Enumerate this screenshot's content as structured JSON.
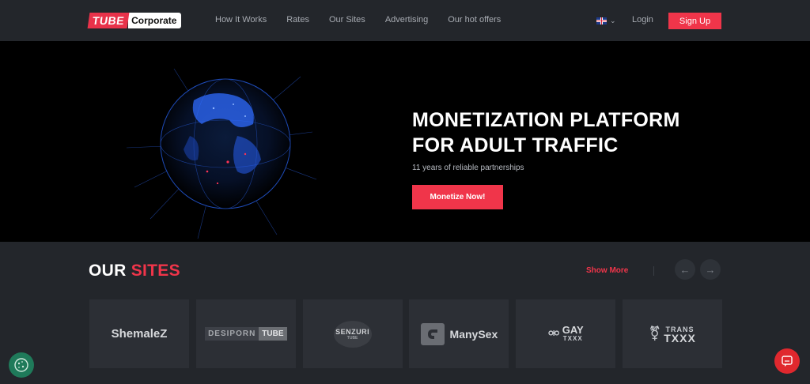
{
  "header": {
    "logo_tube": "TUBE",
    "logo_corp": "Corporate",
    "nav": [
      "How It Works",
      "Rates",
      "Our Sites",
      "Advertising",
      "Our hot offers"
    ],
    "language_icon": "uk-flag-icon",
    "login": "Login",
    "signup": "Sign Up"
  },
  "hero": {
    "title_line1": "MONETIZATION PLATFORM",
    "title_line2": "FOR ADULT TRAFFIC",
    "subtitle": "11 years of reliable partnerships",
    "cta": "Monetize Now!"
  },
  "sites": {
    "title_white": "OUR ",
    "title_red": "SITES",
    "show_more": "Show More",
    "prev_icon": "arrow-left-icon",
    "next_icon": "arrow-right-icon",
    "cards": {
      "shemalez": "ShemaleZ",
      "desi_a": "DESIPORN",
      "desi_b": "TUBE",
      "senzuri_a": "SENZURI",
      "senzuri_b": "TUBE",
      "manysex": "ManySex",
      "gay_a": "GAY",
      "gay_b": "TXXX",
      "trans_a": "TRANS",
      "trans_b": "TXXX"
    }
  },
  "colors": {
    "accent": "#f0354a",
    "background": "#23262b",
    "card": "#2c2f35",
    "cookie": "#1f7a5a",
    "chat": "#e0282e"
  }
}
